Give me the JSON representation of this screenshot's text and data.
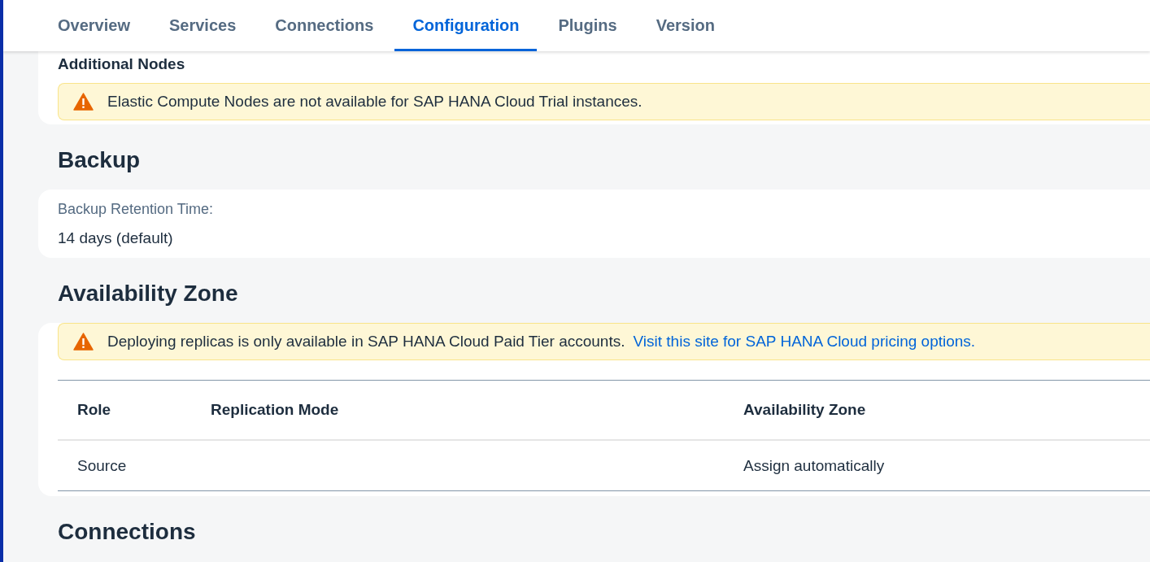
{
  "tabs": [
    {
      "label": "Overview",
      "selected": false
    },
    {
      "label": "Services",
      "selected": false
    },
    {
      "label": "Connections",
      "selected": false
    },
    {
      "label": "Configuration",
      "selected": true
    },
    {
      "label": "Plugins",
      "selected": false
    },
    {
      "label": "Version",
      "selected": false
    }
  ],
  "additional_nodes": {
    "title": "Additional Nodes",
    "warning": {
      "text": "Elastic Compute Nodes are not available for SAP HANA Cloud Trial instances."
    }
  },
  "backup": {
    "heading": "Backup",
    "label": "Backup Retention Time:",
    "value": "14 days (default)"
  },
  "availability_zone": {
    "heading": "Availability Zone",
    "warning": {
      "text": "Deploying replicas is only available in SAP HANA Cloud Paid Tier accounts.",
      "link": "Visit this site for SAP HANA Cloud pricing options."
    },
    "table": {
      "columns": [
        "Role",
        "Replication Mode",
        "Availability Zone"
      ],
      "rows": [
        [
          "Source",
          "",
          "Assign automatically"
        ]
      ]
    }
  },
  "next_heading": "Connections"
}
